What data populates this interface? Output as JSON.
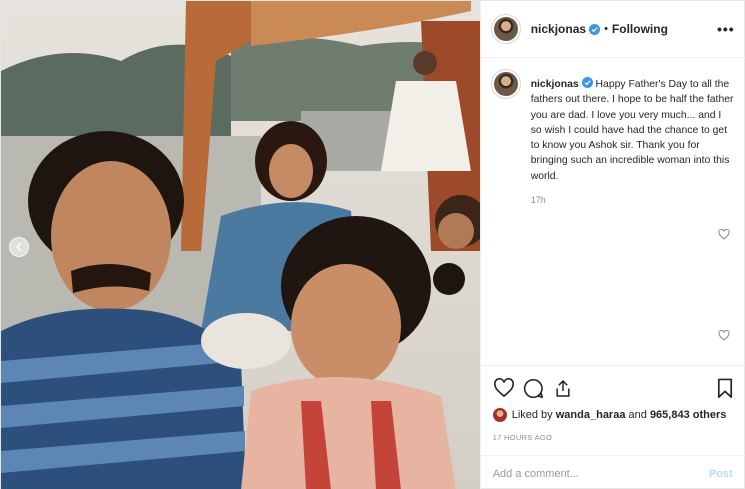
{
  "post": {
    "username": "nickjonas",
    "follow_status": "Following",
    "dot": "•",
    "more_label": "•••",
    "caption_text": "Happy Father's Day to all the fathers out there. I hope to be half the father you are dad. I love you very much... and I so wish I could have had the chance to get to know you Ashok sir. Thank you for bringing such an incredible woman into this world.",
    "caption_time": "17h",
    "likes_prefix": "Liked by ",
    "likes_user": "wanda_haraa",
    "likes_mid": " and ",
    "likes_count": "965,843 others",
    "age": "17 HOURS AGO",
    "comment_placeholder": "Add a comment...",
    "post_label": "Post"
  },
  "colors": {
    "verified": "#3897f0",
    "post_disabled": "#b2dffc",
    "muted": "#8e8e8e"
  },
  "icons": {
    "carousel_prev": "chevron-left-icon",
    "like": "heart-icon",
    "comment": "comment-icon",
    "share": "share-icon",
    "save": "bookmark-icon",
    "more": "more-icon",
    "verified": "verified-badge-icon"
  }
}
